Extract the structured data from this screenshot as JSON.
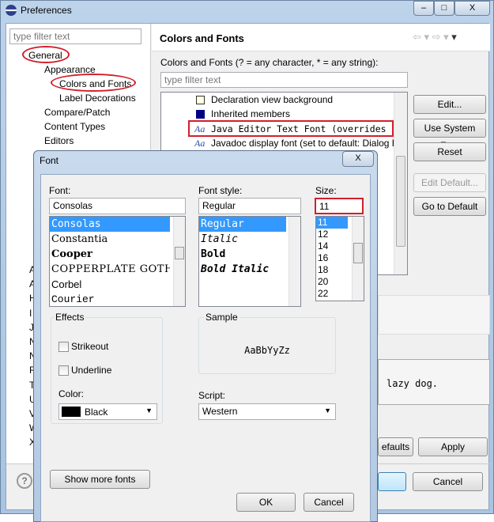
{
  "window": {
    "title": "Preferences",
    "min": "–",
    "max": "□",
    "close": "X"
  },
  "left": {
    "filter_placeholder": "type filter text",
    "tree": [
      {
        "label": "General",
        "level": 0,
        "circled": true
      },
      {
        "label": "Appearance",
        "level": 1
      },
      {
        "label": "Colors and Fonts",
        "level": 2,
        "circled": true
      },
      {
        "label": "Label Decorations",
        "level": 2
      },
      {
        "label": "Compare/Patch",
        "level": 1
      },
      {
        "label": "Content Types",
        "level": 1
      },
      {
        "label": "Editors",
        "level": 1
      }
    ],
    "partial": [
      "A",
      "A",
      "H",
      "I",
      "J",
      "N",
      "N",
      "R",
      "T",
      "U",
      "V",
      "W",
      "X"
    ]
  },
  "right": {
    "title": "Colors and Fonts",
    "desc": "Colors and Fonts (? = any character, * = any string):",
    "filter_placeholder": "type filter text",
    "items": [
      {
        "icon": "color-swatch",
        "color": "#ffffe1",
        "label": "Declaration view background"
      },
      {
        "icon": "color-swatch",
        "color": "#000080",
        "label": "Inherited members"
      },
      {
        "icon": "font",
        "label": "Java Editor Text Font (overrides",
        "highlighted": true
      },
      {
        "icon": "font",
        "label": "Javadoc display font (set to default: Dialog F"
      }
    ],
    "buttons": {
      "edit": "Edit...",
      "system": "Use System Font",
      "reset": "Reset",
      "edit_default": "Edit Default...",
      "goto_default": "Go to Default"
    },
    "preview": "lazy dog.",
    "restore": "efaults",
    "apply": "Apply",
    "ok": "",
    "cancel": "Cancel",
    "help": "?"
  },
  "font_dialog": {
    "title": "Font",
    "close": "X",
    "font_label": "Font:",
    "font_value": "Consolas",
    "fonts": [
      "Consolas",
      "Constantia",
      "Cooper",
      "COPPERPLATE GOTHIC",
      "Corbel",
      "Courier"
    ],
    "style_label": "Font style:",
    "style_value": "Regular",
    "styles": [
      "Regular",
      "Italic",
      "Bold",
      "Bold Italic"
    ],
    "size_label": "Size:",
    "size_value": "11",
    "sizes": [
      "11",
      "12",
      "14",
      "16",
      "18",
      "20",
      "22"
    ],
    "effects_label": "Effects",
    "strikeout": "Strikeout",
    "underline": "Underline",
    "color_label": "Color:",
    "color_value": "Black",
    "color_swatch": "#000000",
    "sample_label": "Sample",
    "sample_text": "AaBbYyZz",
    "script_label": "Script:",
    "script_value": "Western",
    "show_more": "Show more fonts",
    "ok": "OK",
    "cancel": "Cancel"
  },
  "accent": "#3399ff",
  "highlight": "#d2202a"
}
